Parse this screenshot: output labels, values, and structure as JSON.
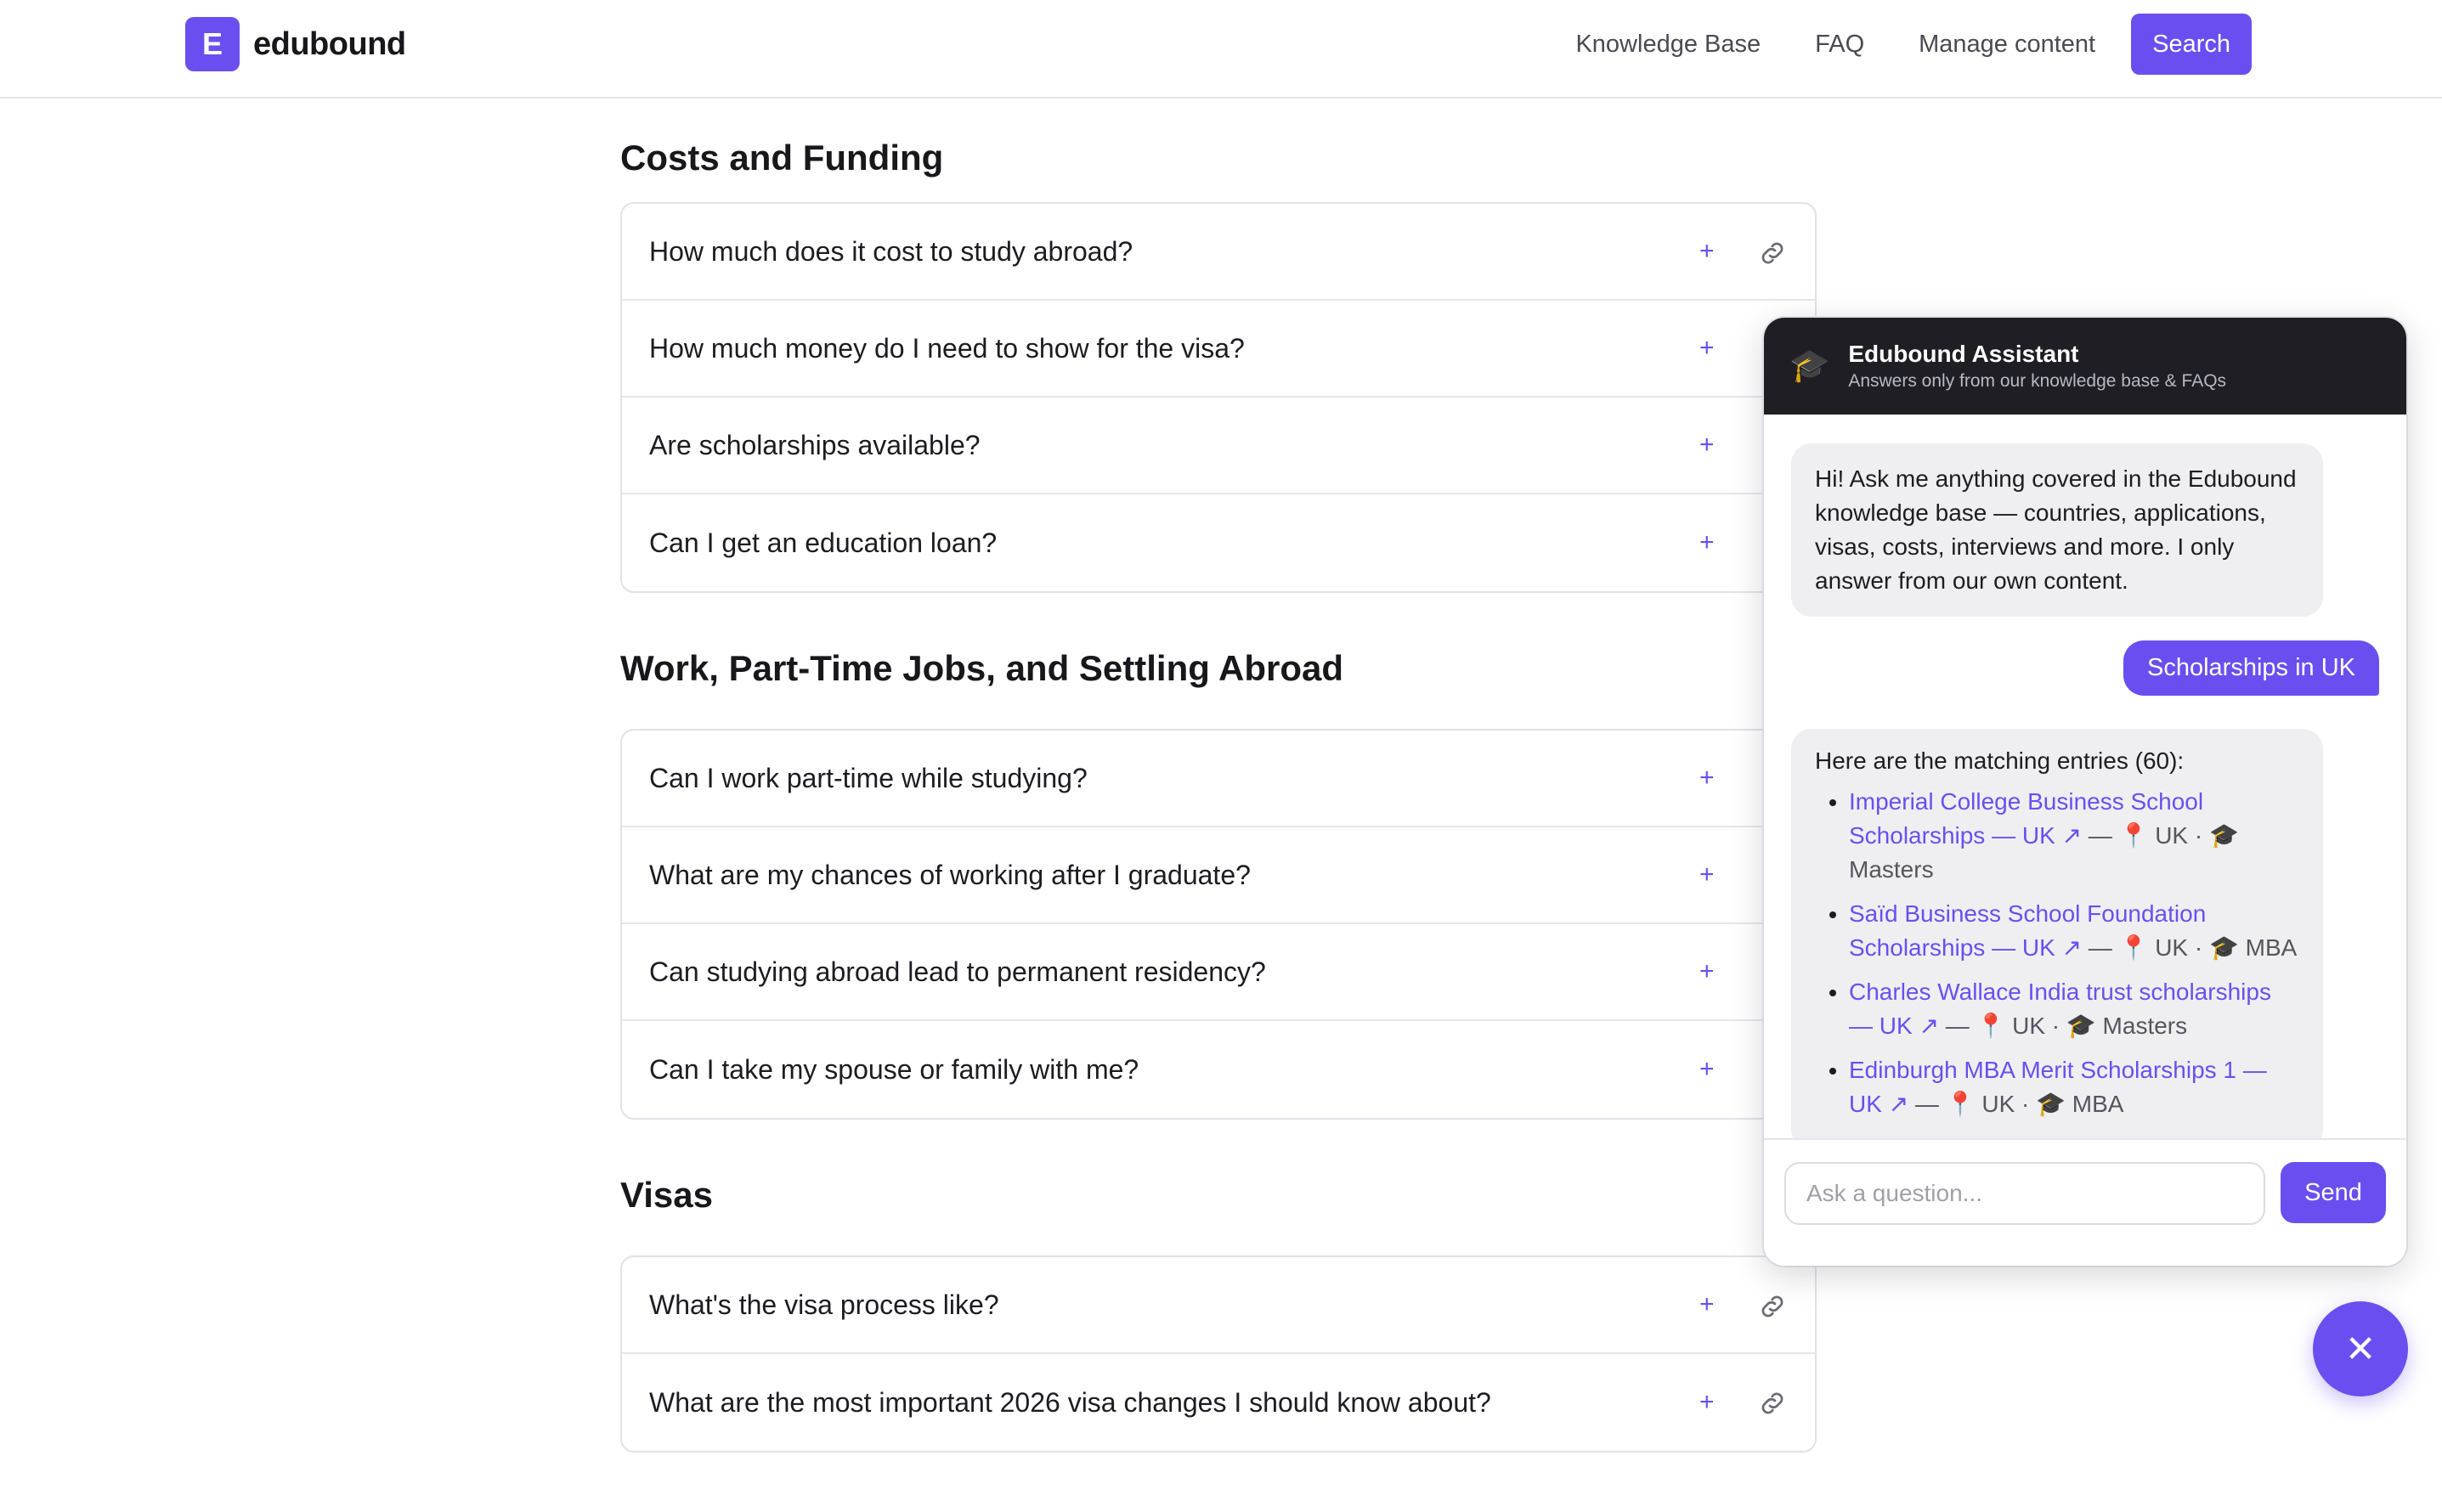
{
  "header": {
    "brand_letter": "E",
    "brand_name": "edubound",
    "nav": [
      "Knowledge Base",
      "FAQ",
      "Manage content"
    ],
    "search_label": "Search"
  },
  "sections": [
    {
      "title": "Costs and Funding",
      "questions": [
        "How much does it cost to study abroad?",
        "How much money do I need to show for the visa?",
        "Are scholarships available?",
        "Can I get an education loan?"
      ]
    },
    {
      "title": "Work, Part-Time Jobs, and Settling Abroad",
      "questions": [
        "Can I work part-time while studying?",
        "What are my chances of working after I graduate?",
        "Can studying abroad lead to permanent residency?",
        "Can I take my spouse or family with me?"
      ]
    },
    {
      "title": "Visas",
      "questions": [
        "What's the visa process like?",
        "What are the most important 2026 visa changes I should know about?"
      ]
    }
  ],
  "chat": {
    "title": "Edubound Assistant",
    "subtitle": "Answers only from our knowledge base & FAQs",
    "greeting": "Hi! Ask me anything covered in the Edubound knowledge base — countries, applications, visas, costs, interviews and more. I only answer from our own content.",
    "user_message": "Scholarships in UK",
    "results_intro": "Here are the matching entries (60):",
    "results": [
      {
        "name": "Imperial College Business School Scholarships — UK ↗",
        "meta": " — 📍 UK · 🎓 Masters"
      },
      {
        "name": "Saïd Business School Foundation Scholarships — UK ↗",
        "meta": " — 📍 UK · 🎓 MBA"
      },
      {
        "name": "Charles Wallace India trust scholarships — UK ↗",
        "meta": " — 📍 UK · 🎓 Masters"
      },
      {
        "name": "Edinburgh MBA Merit Scholarships 1 — UK ↗",
        "meta": " — 📍 UK · 🎓 MBA"
      }
    ],
    "input_placeholder": "Ask a question...",
    "send_label": "Send",
    "close_label": "✕"
  },
  "colors": {
    "accent": "#6b4ef0",
    "chat_header": "#1e1e24",
    "bot_bubble": "#efeff2"
  }
}
